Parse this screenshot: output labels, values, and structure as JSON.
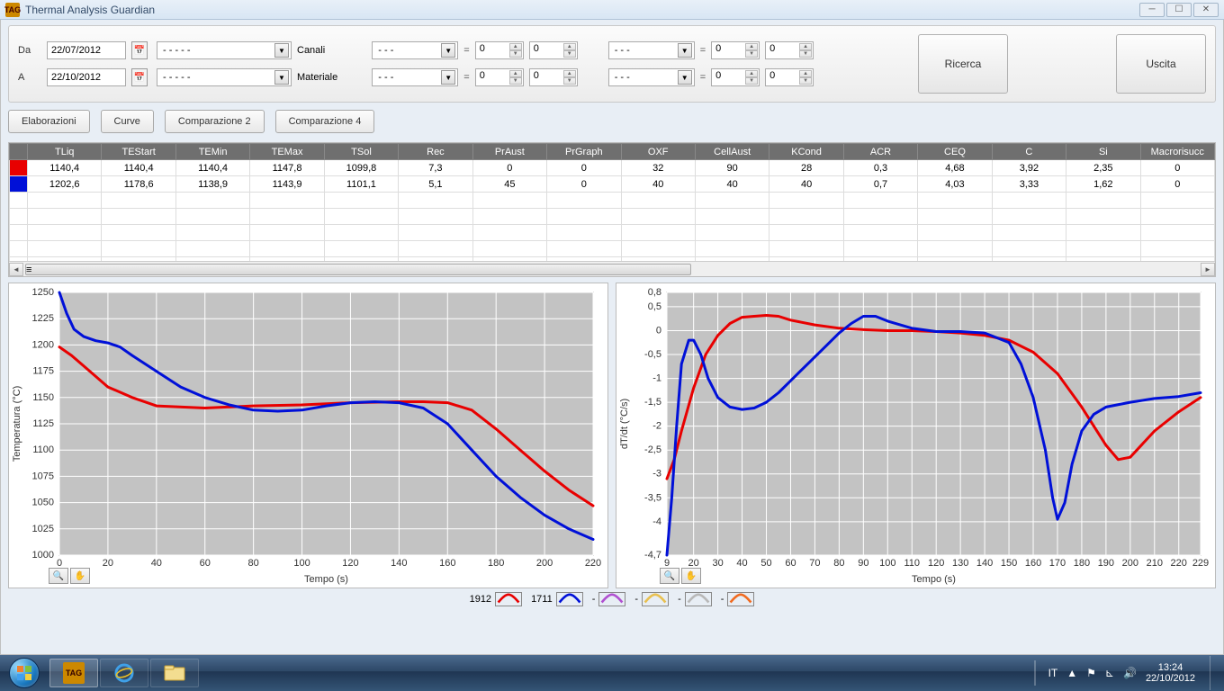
{
  "window": {
    "title": "Thermal Analysis Guardian"
  },
  "filters": {
    "da_label": "Da",
    "da_value": "22/07/2012",
    "a_label": "A",
    "a_value": "22/10/2012",
    "combo1": "- - - - -",
    "canali_label": "Canali",
    "combo2": "- - - - -",
    "materiale_label": "Materiale",
    "dash": "- - -",
    "eq": "=",
    "zero": "0",
    "ricerca": "Ricerca",
    "uscita": "Uscita"
  },
  "toolbar": {
    "elaborazioni": "Elaborazioni",
    "curve": "Curve",
    "comp2": "Comparazione 2",
    "comp4": "Comparazione 4"
  },
  "table": {
    "headers": [
      "",
      "TLiq",
      "TEStart",
      "TEMin",
      "TEMax",
      "TSol",
      "Rec",
      "PrAust",
      "PrGraph",
      "OXF",
      "CellAust",
      "KCond",
      "ACR",
      "CEQ",
      "C",
      "Si",
      "Macrorisucc"
    ],
    "rows": [
      {
        "color": "#e80000",
        "cells": [
          "1140,4",
          "1140,4",
          "1140,4",
          "1147,8",
          "1099,8",
          "7,3",
          "0",
          "0",
          "32",
          "90",
          "28",
          "0,3",
          "4,68",
          "3,92",
          "2,35",
          "0"
        ]
      },
      {
        "color": "#0010d8",
        "cells": [
          "1202,6",
          "1178,6",
          "1138,9",
          "1143,9",
          "1101,1",
          "5,1",
          "45",
          "0",
          "40",
          "40",
          "40",
          "0,7",
          "4,03",
          "3,33",
          "1,62",
          "0"
        ]
      }
    ]
  },
  "legend": {
    "items": [
      {
        "label": "1912",
        "color": "#e80000"
      },
      {
        "label": "1711",
        "color": "#0010d8"
      },
      {
        "label": "-",
        "color": "#b050d0"
      },
      {
        "label": "-",
        "color": "#e8c050"
      },
      {
        "label": "-",
        "color": "#b8b8b8"
      },
      {
        "label": "-",
        "color": "#f06a20"
      }
    ]
  },
  "taskbar": {
    "lang": "IT",
    "time": "13:24",
    "date": "22/10/2012"
  },
  "chart_data": [
    {
      "type": "line",
      "title": "",
      "xlabel": "Tempo (s)",
      "ylabel": "Temperatura (°C)",
      "xlim": [
        0,
        220
      ],
      "ylim": [
        1000,
        1250
      ],
      "xticks": [
        0,
        20,
        40,
        60,
        80,
        100,
        120,
        140,
        160,
        180,
        200,
        220
      ],
      "yticks": [
        1000,
        1025,
        1050,
        1075,
        1100,
        1125,
        1150,
        1175,
        1200,
        1225,
        1250
      ],
      "series": [
        {
          "name": "1912",
          "color": "#e80000",
          "x": [
            0,
            5,
            10,
            15,
            20,
            30,
            40,
            60,
            80,
            100,
            120,
            140,
            150,
            160,
            170,
            180,
            190,
            200,
            210,
            220
          ],
          "y": [
            1198,
            1190,
            1180,
            1170,
            1160,
            1150,
            1142,
            1140,
            1142,
            1143,
            1145,
            1146,
            1146,
            1145,
            1138,
            1120,
            1100,
            1080,
            1062,
            1047
          ]
        },
        {
          "name": "1711",
          "color": "#0010d8",
          "x": [
            0,
            3,
            6,
            10,
            15,
            20,
            25,
            30,
            40,
            50,
            60,
            70,
            80,
            90,
            100,
            110,
            120,
            130,
            140,
            150,
            160,
            170,
            180,
            190,
            200,
            210,
            220
          ],
          "y": [
            1250,
            1230,
            1215,
            1208,
            1204,
            1202,
            1198,
            1190,
            1175,
            1160,
            1150,
            1143,
            1138,
            1137,
            1138,
            1142,
            1145,
            1146,
            1145,
            1140,
            1125,
            1100,
            1075,
            1055,
            1038,
            1025,
            1015
          ]
        }
      ]
    },
    {
      "type": "line",
      "title": "",
      "xlabel": "Tempo (s)",
      "ylabel": "dT/dt (°C/s)",
      "xlim": [
        9,
        229
      ],
      "ylim": [
        -4.7,
        0.8
      ],
      "xticks": [
        9,
        20,
        30,
        40,
        50,
        60,
        70,
        80,
        90,
        100,
        110,
        120,
        130,
        140,
        150,
        160,
        170,
        180,
        190,
        200,
        210,
        220,
        229
      ],
      "yticks": [
        -4.7,
        -4,
        -3.5,
        -3,
        -2.5,
        -2,
        -1.5,
        -1,
        -0.5,
        0,
        0.5,
        0.8
      ],
      "series": [
        {
          "name": "1912",
          "color": "#e80000",
          "x": [
            9,
            12,
            15,
            20,
            25,
            30,
            35,
            40,
            45,
            50,
            55,
            60,
            70,
            80,
            90,
            100,
            110,
            120,
            130,
            140,
            150,
            160,
            170,
            180,
            190,
            195,
            200,
            210,
            220,
            229
          ],
          "y": [
            -3.1,
            -2.7,
            -2.1,
            -1.2,
            -0.5,
            -0.1,
            0.15,
            0.28,
            0.3,
            0.32,
            0.3,
            0.22,
            0.12,
            0.05,
            0.02,
            0.0,
            0.0,
            -0.02,
            -0.05,
            -0.1,
            -0.2,
            -0.45,
            -0.9,
            -1.6,
            -2.4,
            -2.7,
            -2.65,
            -2.1,
            -1.7,
            -1.4
          ]
        },
        {
          "name": "1711",
          "color": "#0010d8",
          "x": [
            9,
            11,
            13,
            15,
            18,
            20,
            23,
            26,
            30,
            35,
            40,
            45,
            50,
            55,
            60,
            65,
            70,
            75,
            80,
            85,
            90,
            95,
            100,
            110,
            120,
            130,
            140,
            150,
            155,
            160,
            165,
            168,
            170,
            173,
            176,
            180,
            185,
            190,
            200,
            210,
            220,
            229
          ],
          "y": [
            -4.7,
            -3.5,
            -2.0,
            -0.7,
            -0.2,
            -0.2,
            -0.5,
            -1.0,
            -1.4,
            -1.6,
            -1.65,
            -1.62,
            -1.5,
            -1.3,
            -1.05,
            -0.8,
            -0.55,
            -0.3,
            -0.05,
            0.15,
            0.3,
            0.3,
            0.2,
            0.05,
            -0.02,
            -0.02,
            -0.05,
            -0.25,
            -0.7,
            -1.4,
            -2.5,
            -3.5,
            -3.95,
            -3.6,
            -2.8,
            -2.1,
            -1.75,
            -1.6,
            -1.5,
            -1.42,
            -1.38,
            -1.3
          ]
        }
      ]
    }
  ]
}
